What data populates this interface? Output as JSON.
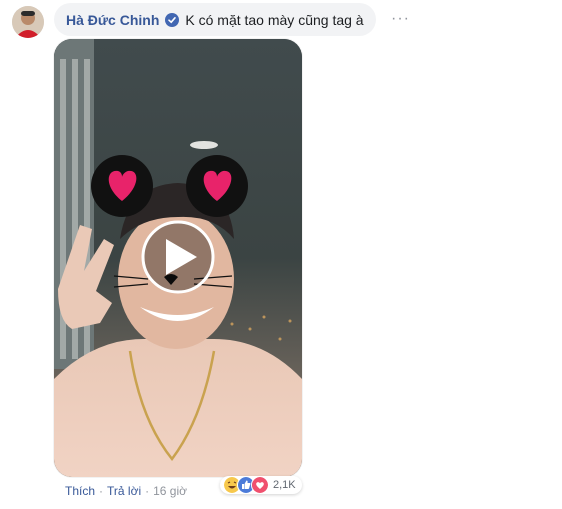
{
  "comment": {
    "author": "Hà Đức Chinh",
    "verified_icon": "verified-badge-icon",
    "text": "K có mặt tao mày cũng tag à",
    "more_label": "···"
  },
  "video": {
    "play_icon": "play-icon"
  },
  "actions": {
    "like_label": "Thích",
    "separator": "·",
    "reply_label": "Trả lời",
    "time_label": "16 giờ"
  },
  "reactions": {
    "icons": [
      "haha-icon",
      "like-icon",
      "love-icon"
    ],
    "count": "2,1K"
  },
  "colors": {
    "link": "#385898",
    "bubble": "#f2f3f5",
    "muted": "#90949c"
  }
}
